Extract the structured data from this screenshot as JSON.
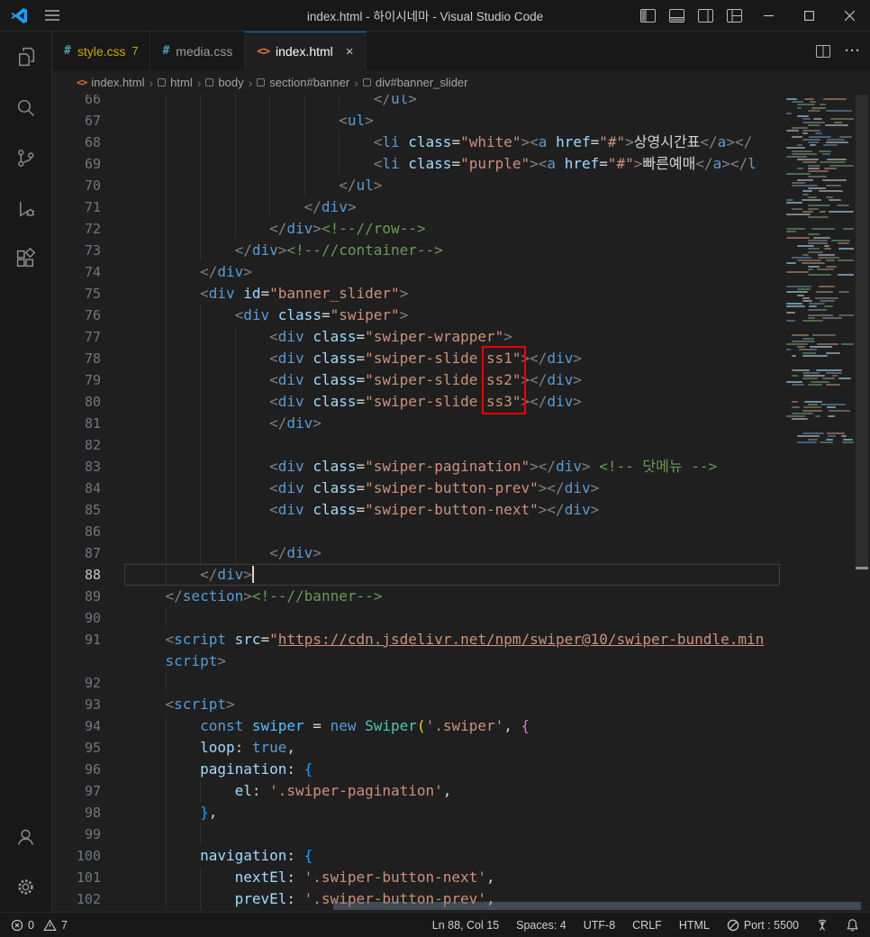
{
  "window": {
    "title": "index.html - 하이시네마 - Visual Studio Code"
  },
  "icons": {
    "css_glyph": "#",
    "html_glyph": "<>",
    "close_glyph": "×",
    "chevron": "›",
    "ellipsis": "···"
  },
  "tabs": [
    {
      "label": "style.css",
      "badge": "7"
    },
    {
      "label": "media.css"
    },
    {
      "label": "index.html"
    }
  ],
  "breadcrumbs": [
    "index.html",
    "html",
    "body",
    "section#banner",
    "div#banner_slider"
  ],
  "editor": {
    "cursor": {
      "line": "88",
      "col_chars": 14
    },
    "annotation": {
      "first_row": 12,
      "num_rows": 3,
      "col_start": 40.7,
      "col_end": 45.4,
      "color": "#f10000"
    },
    "lines": [
      {
        "n": "66",
        "i": 28,
        "tk": [
          [
            "</",
            "p"
          ],
          [
            "ul",
            "t"
          ],
          [
            ">",
            "p"
          ]
        ]
      },
      {
        "n": "67",
        "i": 24,
        "tk": [
          [
            "<",
            "p"
          ],
          [
            "ul",
            "t"
          ],
          [
            ">",
            "p"
          ]
        ]
      },
      {
        "n": "68",
        "i": 28,
        "tk": [
          [
            "<",
            "p"
          ],
          [
            "li",
            "t"
          ],
          [
            " ",
            "d"
          ],
          [
            "class",
            "a"
          ],
          [
            "=",
            "d"
          ],
          [
            "\"white\"",
            "s"
          ],
          [
            ">",
            "p"
          ],
          [
            "<",
            "p"
          ],
          [
            "a",
            "t"
          ],
          [
            " ",
            "d"
          ],
          [
            "href",
            "a"
          ],
          [
            "=",
            "d"
          ],
          [
            "\"#\"",
            "s"
          ],
          [
            ">",
            "p"
          ],
          [
            "상영시간표",
            "d"
          ],
          [
            "</",
            "p"
          ],
          [
            "a",
            "t"
          ],
          [
            ">",
            "p"
          ],
          [
            "</",
            "p"
          ]
        ]
      },
      {
        "n": "69",
        "i": 28,
        "tk": [
          [
            "<",
            "p"
          ],
          [
            "li",
            "t"
          ],
          [
            " ",
            "d"
          ],
          [
            "class",
            "a"
          ],
          [
            "=",
            "d"
          ],
          [
            "\"purple\"",
            "s"
          ],
          [
            ">",
            "p"
          ],
          [
            "<",
            "p"
          ],
          [
            "a",
            "t"
          ],
          [
            " ",
            "d"
          ],
          [
            "href",
            "a"
          ],
          [
            "=",
            "d"
          ],
          [
            "\"#\"",
            "s"
          ],
          [
            ">",
            "p"
          ],
          [
            "빠른예매",
            "d"
          ],
          [
            "</",
            "p"
          ],
          [
            "a",
            "t"
          ],
          [
            ">",
            "p"
          ],
          [
            "</",
            "p"
          ],
          [
            "l",
            "t"
          ]
        ]
      },
      {
        "n": "70",
        "i": 24,
        "tk": [
          [
            "</",
            "p"
          ],
          [
            "ul",
            "t"
          ],
          [
            ">",
            "p"
          ]
        ]
      },
      {
        "n": "71",
        "i": 20,
        "tk": [
          [
            "</",
            "p"
          ],
          [
            "div",
            "t"
          ],
          [
            ">",
            "p"
          ]
        ]
      },
      {
        "n": "72",
        "i": 16,
        "tk": [
          [
            "</",
            "p"
          ],
          [
            "div",
            "t"
          ],
          [
            ">",
            "p"
          ],
          [
            "<!--//row-->",
            "c"
          ]
        ]
      },
      {
        "n": "73",
        "i": 12,
        "tk": [
          [
            "</",
            "p"
          ],
          [
            "div",
            "t"
          ],
          [
            ">",
            "p"
          ],
          [
            "<!--//container-->",
            "c"
          ]
        ]
      },
      {
        "n": "74",
        "i": 8,
        "tk": [
          [
            "</",
            "p"
          ],
          [
            "div",
            "t"
          ],
          [
            ">",
            "p"
          ]
        ]
      },
      {
        "n": "75",
        "i": 8,
        "tk": [
          [
            "<",
            "p"
          ],
          [
            "div",
            "t"
          ],
          [
            " ",
            "d"
          ],
          [
            "id",
            "a"
          ],
          [
            "=",
            "d"
          ],
          [
            "\"banner_slider\"",
            "s"
          ],
          [
            ">",
            "p"
          ]
        ]
      },
      {
        "n": "76",
        "i": 12,
        "tk": [
          [
            "<",
            "p"
          ],
          [
            "div",
            "t"
          ],
          [
            " ",
            "d"
          ],
          [
            "class",
            "a"
          ],
          [
            "=",
            "d"
          ],
          [
            "\"swiper\"",
            "s"
          ],
          [
            ">",
            "p"
          ]
        ]
      },
      {
        "n": "77",
        "i": 16,
        "tk": [
          [
            "<",
            "p"
          ],
          [
            "div",
            "t"
          ],
          [
            " ",
            "d"
          ],
          [
            "class",
            "a"
          ],
          [
            "=",
            "d"
          ],
          [
            "\"swiper-wrapper\"",
            "s"
          ],
          [
            ">",
            "p"
          ]
        ]
      },
      {
        "n": "78",
        "i": 16,
        "tk": [
          [
            "<",
            "p"
          ],
          [
            "div",
            "t"
          ],
          [
            " ",
            "d"
          ],
          [
            "class",
            "a"
          ],
          [
            "=",
            "d"
          ],
          [
            "\"swiper-slide ss1\"",
            "s"
          ],
          [
            ">",
            "p"
          ],
          [
            "</",
            "p"
          ],
          [
            "div",
            "t"
          ],
          [
            ">",
            "p"
          ]
        ]
      },
      {
        "n": "79",
        "i": 16,
        "tk": [
          [
            "<",
            "p"
          ],
          [
            "div",
            "t"
          ],
          [
            " ",
            "d"
          ],
          [
            "class",
            "a"
          ],
          [
            "=",
            "d"
          ],
          [
            "\"swiper-slide ss2\"",
            "s"
          ],
          [
            ">",
            "p"
          ],
          [
            "</",
            "p"
          ],
          [
            "div",
            "t"
          ],
          [
            ">",
            "p"
          ]
        ]
      },
      {
        "n": "80",
        "i": 16,
        "tk": [
          [
            "<",
            "p"
          ],
          [
            "div",
            "t"
          ],
          [
            " ",
            "d"
          ],
          [
            "class",
            "a"
          ],
          [
            "=",
            "d"
          ],
          [
            "\"swiper-slide ss3\"",
            "s"
          ],
          [
            ">",
            "p"
          ],
          [
            "</",
            "p"
          ],
          [
            "div",
            "t"
          ],
          [
            ">",
            "p"
          ]
        ]
      },
      {
        "n": "81",
        "i": 16,
        "tk": [
          [
            "</",
            "p"
          ],
          [
            "div",
            "t"
          ],
          [
            ">",
            "p"
          ]
        ]
      },
      {
        "n": "82",
        "i": 16,
        "tk": []
      },
      {
        "n": "83",
        "i": 16,
        "tk": [
          [
            "<",
            "p"
          ],
          [
            "div",
            "t"
          ],
          [
            " ",
            "d"
          ],
          [
            "class",
            "a"
          ],
          [
            "=",
            "d"
          ],
          [
            "\"swiper-pagination\"",
            "s"
          ],
          [
            ">",
            "p"
          ],
          [
            "</",
            "p"
          ],
          [
            "div",
            "t"
          ],
          [
            ">",
            "p"
          ],
          [
            " ",
            "d"
          ],
          [
            "<!-- 닷메뉴 -->",
            "c"
          ]
        ]
      },
      {
        "n": "84",
        "i": 16,
        "tk": [
          [
            "<",
            "p"
          ],
          [
            "div",
            "t"
          ],
          [
            " ",
            "d"
          ],
          [
            "class",
            "a"
          ],
          [
            "=",
            "d"
          ],
          [
            "\"swiper-button-prev\"",
            "s"
          ],
          [
            ">",
            "p"
          ],
          [
            "</",
            "p"
          ],
          [
            "div",
            "t"
          ],
          [
            ">",
            "p"
          ]
        ]
      },
      {
        "n": "85",
        "i": 16,
        "tk": [
          [
            "<",
            "p"
          ],
          [
            "div",
            "t"
          ],
          [
            " ",
            "d"
          ],
          [
            "class",
            "a"
          ],
          [
            "=",
            "d"
          ],
          [
            "\"swiper-button-next\"",
            "s"
          ],
          [
            ">",
            "p"
          ],
          [
            "</",
            "p"
          ],
          [
            "div",
            "t"
          ],
          [
            ">",
            "p"
          ]
        ]
      },
      {
        "n": "86",
        "i": 16,
        "tk": []
      },
      {
        "n": "87",
        "i": 16,
        "tk": [
          [
            "</",
            "p"
          ],
          [
            "div",
            "t"
          ],
          [
            ">",
            "p"
          ]
        ]
      },
      {
        "n": "88",
        "i": 8,
        "cur": true,
        "tk": [
          [
            "</",
            "p"
          ],
          [
            "div",
            "t"
          ],
          [
            ">",
            "p"
          ]
        ]
      },
      {
        "n": "89",
        "i": 4,
        "tk": [
          [
            "</",
            "p"
          ],
          [
            "section",
            "t"
          ],
          [
            ">",
            "p"
          ],
          [
            "<!--//banner-->",
            "c"
          ]
        ]
      },
      {
        "n": "90",
        "i": 8,
        "tk": []
      },
      {
        "n": "91",
        "i": 4,
        "tk": [
          [
            "<",
            "p"
          ],
          [
            "script",
            "t"
          ],
          [
            " ",
            "d"
          ],
          [
            "src",
            "a"
          ],
          [
            "=",
            "d"
          ],
          [
            "\"",
            "s"
          ],
          [
            "https://cdn.jsdelivr.net/npm/swiper@10/swiper-bundle.min",
            "su"
          ]
        ]
      },
      {
        "n": "",
        "i": 4,
        "tk": [
          [
            "script",
            "t"
          ],
          [
            ">",
            "p"
          ]
        ]
      },
      {
        "n": "92",
        "i": 8,
        "tk": []
      },
      {
        "n": "93",
        "i": 4,
        "tk": [
          [
            "<",
            "p"
          ],
          [
            "script",
            "t"
          ],
          [
            ">",
            "p"
          ]
        ]
      },
      {
        "n": "94",
        "i": 8,
        "tk": [
          [
            "const",
            "k"
          ],
          [
            " ",
            "d"
          ],
          [
            "swiper",
            "v"
          ],
          [
            " = ",
            "d"
          ],
          [
            "new",
            "k"
          ],
          [
            " ",
            "d"
          ],
          [
            "Swiper",
            "cl"
          ],
          [
            "(",
            "b1"
          ],
          [
            "'.swiper'",
            "s"
          ],
          [
            ", ",
            "d"
          ],
          [
            "{",
            "b2"
          ]
        ]
      },
      {
        "n": "95",
        "i": 8,
        "tk": [
          [
            "loop",
            "pr"
          ],
          [
            ": ",
            "d"
          ],
          [
            "true",
            "k"
          ],
          [
            ",",
            "d"
          ]
        ]
      },
      {
        "n": "96",
        "i": 8,
        "tk": [
          [
            "pagination",
            "pr"
          ],
          [
            ": ",
            "d"
          ],
          [
            "{",
            "b3"
          ]
        ]
      },
      {
        "n": "97",
        "i": 12,
        "tk": [
          [
            "el",
            "pr"
          ],
          [
            ": ",
            "d"
          ],
          [
            "'.swiper-pagination'",
            "s"
          ],
          [
            ",",
            "d"
          ]
        ]
      },
      {
        "n": "98",
        "i": 8,
        "tk": [
          [
            "}",
            "b3"
          ],
          [
            ",",
            "d"
          ]
        ]
      },
      {
        "n": "99",
        "i": 12,
        "tk": []
      },
      {
        "n": "100",
        "i": 8,
        "tk": [
          [
            "navigation",
            "pr"
          ],
          [
            ": ",
            "d"
          ],
          [
            "{",
            "b3"
          ]
        ]
      },
      {
        "n": "101",
        "i": 12,
        "tk": [
          [
            "nextEl",
            "pr"
          ],
          [
            ": ",
            "d"
          ],
          [
            "'.swiper-button-next'",
            "s"
          ],
          [
            ",",
            "d"
          ]
        ]
      },
      {
        "n": "102",
        "i": 12,
        "tk": [
          [
            "prevEl",
            "pr"
          ],
          [
            ": ",
            "d"
          ],
          [
            "'.swiper-button-prev'",
            "s"
          ],
          [
            ",",
            "d"
          ]
        ]
      }
    ]
  },
  "status": {
    "errors": "0",
    "warnings": "7",
    "line_col": "Ln 88, Col 15",
    "spaces": "Spaces: 4",
    "encoding": "UTF-8",
    "eol": "CRLF",
    "language": "HTML",
    "port": "Port : 5500"
  }
}
